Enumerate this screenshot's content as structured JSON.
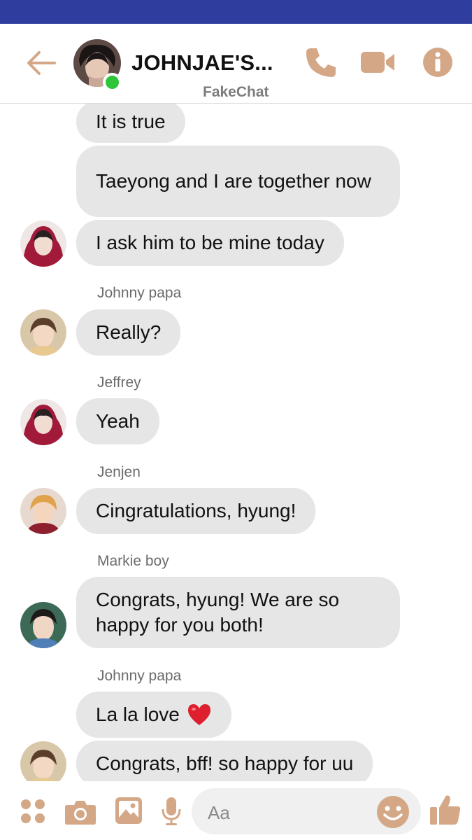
{
  "header": {
    "title": "JOHNJAE'S...",
    "subtitle": "FakeChat",
    "accent_color": "#d4a887",
    "icons": [
      "back-arrow-icon",
      "phone-icon",
      "video-camera-icon",
      "info-icon"
    ]
  },
  "messages": [
    {
      "text": "It is true"
    },
    {
      "text": "Taeyong and I are together now"
    },
    {
      "text": "I ask him to be mine today"
    },
    {
      "sender": "Johnny papa",
      "text": "Really?"
    },
    {
      "sender": "Jeffrey",
      "text": "Yeah"
    },
    {
      "sender": "Jenjen",
      "text": "Cingratulations, hyung!"
    },
    {
      "sender": "Markie boy",
      "text": "Congrats, hyung! We are so happy for you both!"
    },
    {
      "sender": "Johnny papa",
      "text": "La la love",
      "emoji": "heart"
    },
    {
      "text": "Congrats, bff! so happy for uu"
    }
  ],
  "composer": {
    "placeholder": "Aa",
    "icons": [
      "apps-grid-icon",
      "camera-icon",
      "gallery-icon",
      "microphone-icon",
      "emoji-icon",
      "thumbs-up-icon"
    ]
  }
}
